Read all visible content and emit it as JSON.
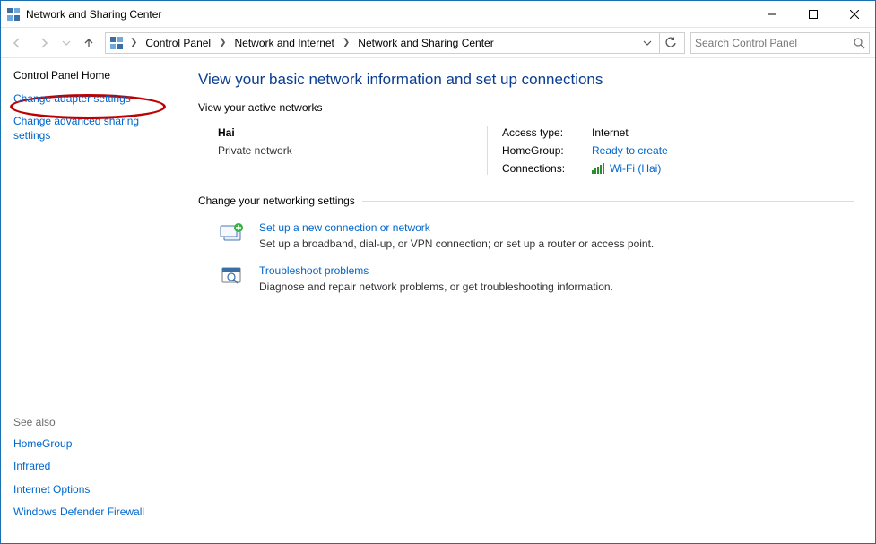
{
  "window": {
    "title": "Network and Sharing Center"
  },
  "breadcrumb": {
    "items": [
      "Control Panel",
      "Network and Internet",
      "Network and Sharing Center"
    ]
  },
  "search": {
    "placeholder": "Search Control Panel"
  },
  "sidebar": {
    "home": "Control Panel Home",
    "link_adapter": "Change adapter settings",
    "link_advanced": "Change advanced sharing settings",
    "see_also_label": "See also",
    "see_also": [
      "HomeGroup",
      "Infrared",
      "Internet Options",
      "Windows Defender Firewall"
    ]
  },
  "main": {
    "heading": "View your basic network information and set up connections",
    "active_header": "View your active networks",
    "network": {
      "name": "Hai",
      "type": "Private network",
      "access_label": "Access type:",
      "access_value": "Internet",
      "homegroup_label": "HomeGroup:",
      "homegroup_value": "Ready to create",
      "connections_label": "Connections:",
      "connections_value": "Wi-Fi (Hai)"
    },
    "change_header": "Change your networking settings",
    "task1": {
      "title": "Set up a new connection or network",
      "desc": "Set up a broadband, dial-up, or VPN connection; or set up a router or access point."
    },
    "task2": {
      "title": "Troubleshoot problems",
      "desc": "Diagnose and repair network problems, or get troubleshooting information."
    }
  }
}
